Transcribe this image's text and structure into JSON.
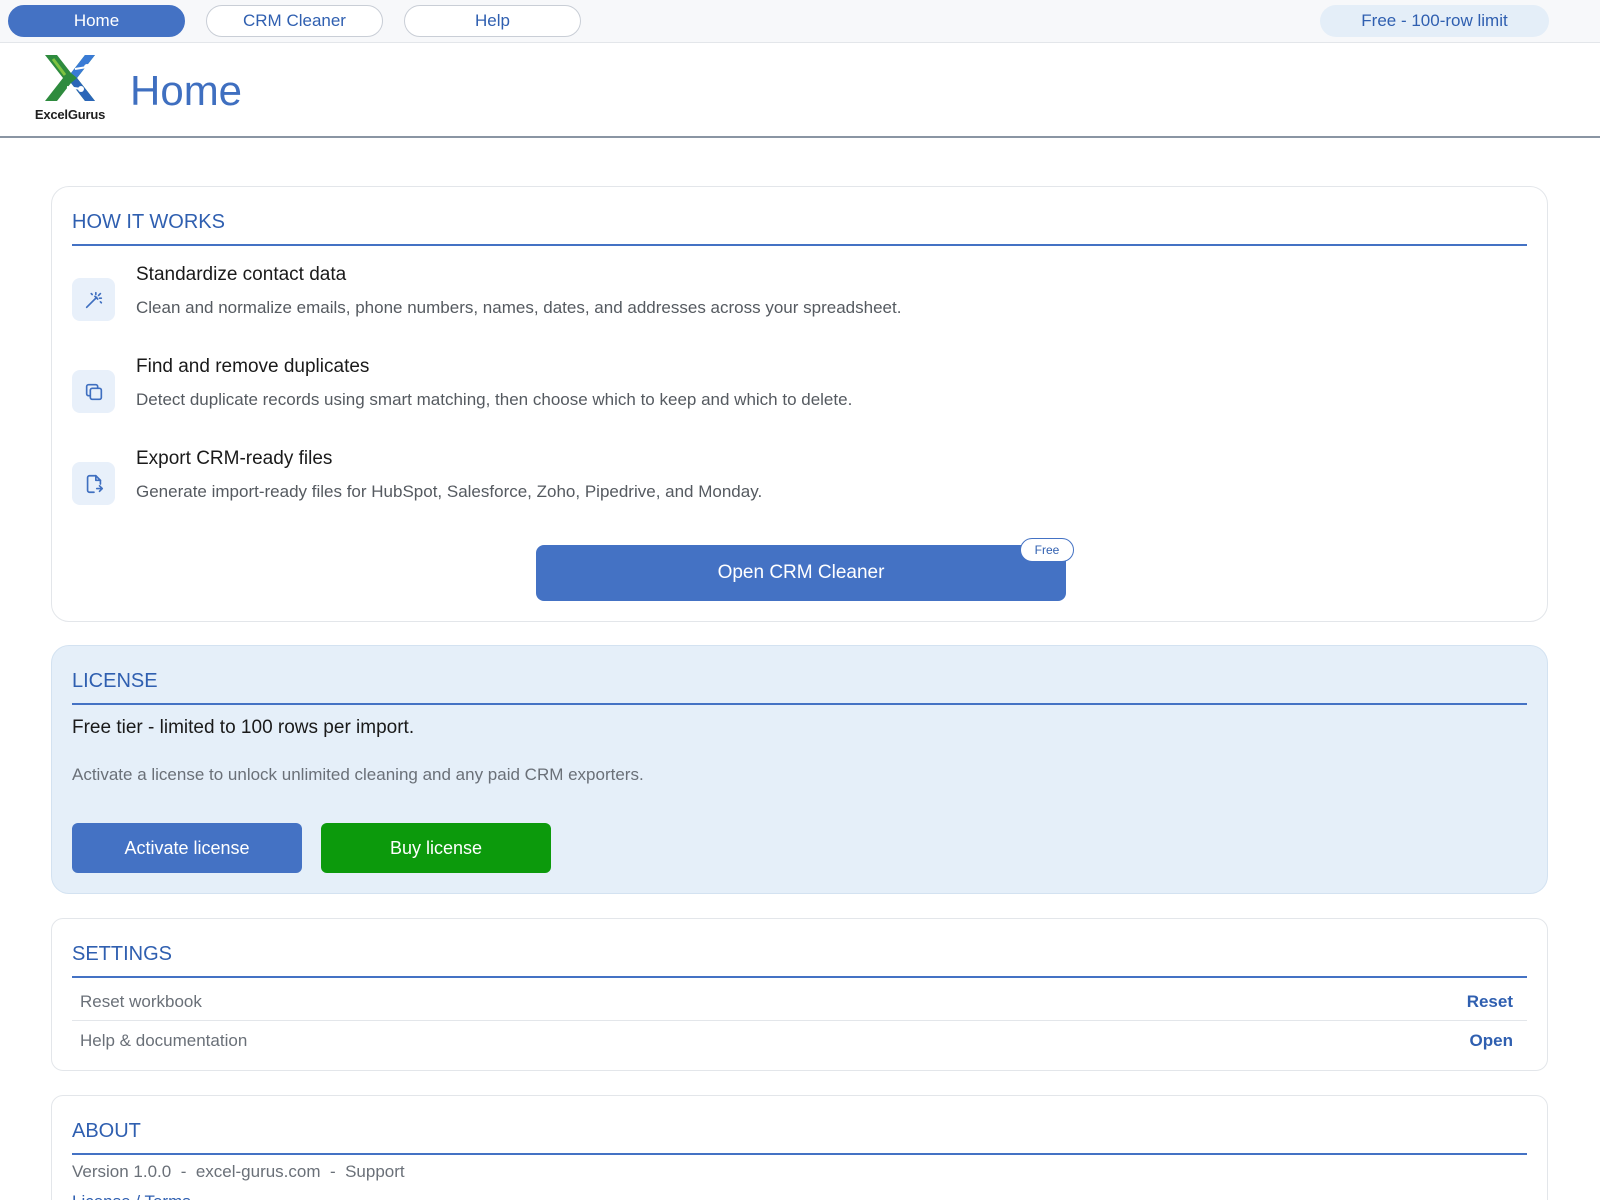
{
  "nav": {
    "home": "Home",
    "crm_cleaner": "CRM Cleaner",
    "help": "Help",
    "tier": "Free - 100-row limit"
  },
  "header": {
    "logo_text": "ExcelGurus",
    "title": "Home"
  },
  "how_it_works": {
    "title": "HOW IT WORKS",
    "features": [
      {
        "icon": "magic-wand-icon",
        "title": "Standardize contact data",
        "desc": "Clean and normalize emails, phone numbers, names, dates, and addresses across your spreadsheet."
      },
      {
        "icon": "duplicate-icon",
        "title": "Find and remove duplicates",
        "desc": "Detect duplicate records using smart matching, then choose which to keep and which to delete."
      },
      {
        "icon": "file-export-icon",
        "title": "Export CRM-ready files",
        "desc": "Generate import-ready files for HubSpot, Salesforce, Zoho, Pipedrive, and Monday."
      }
    ],
    "open_button": "Open CRM Cleaner",
    "free_badge": "Free"
  },
  "license": {
    "title": "LICENSE",
    "status": "Free tier - limited to 100 rows per import.",
    "note": "Activate a license to unlock unlimited cleaning and any paid CRM exporters.",
    "activate": "Activate license",
    "buy": "Buy license"
  },
  "settings": {
    "title": "SETTINGS",
    "rows": [
      {
        "label": "Reset workbook",
        "action": "Reset"
      },
      {
        "label": "Help & documentation",
        "action": "Open"
      }
    ]
  },
  "about": {
    "title": "ABOUT",
    "version": "Version 1.0.0",
    "sep": "  -  ",
    "site": "excel-gurus.com",
    "support": "Support",
    "license_terms": "License / Terms"
  },
  "colors": {
    "accent": "#4472c4",
    "buy_green": "#0c9a0c",
    "license_bg": "#e5eff9"
  }
}
